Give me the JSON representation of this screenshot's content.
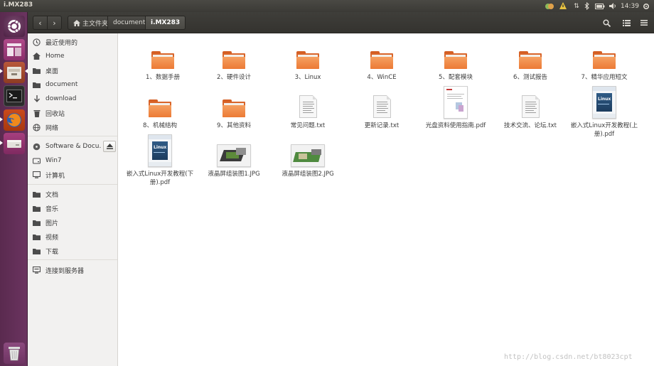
{
  "window": {
    "title": "i.MX283"
  },
  "panel": {
    "time": "14:39"
  },
  "header": {
    "breadcrumbs": [
      {
        "label": "主文件夹",
        "active": false
      },
      {
        "label": "document",
        "active": false
      },
      {
        "label": "i.MX283",
        "active": true
      }
    ]
  },
  "sidebar": {
    "places": [
      {
        "label": "最近使用的",
        "icon": "clock-icon"
      },
      {
        "label": "Home",
        "icon": "home-icon"
      },
      {
        "label": "桌面",
        "icon": "folder-icon"
      },
      {
        "label": "document",
        "icon": "folder-icon"
      },
      {
        "label": "download",
        "icon": "download-icon"
      },
      {
        "label": "回收站",
        "icon": "trash-icon"
      },
      {
        "label": "网络",
        "icon": "network-icon"
      }
    ],
    "devices": [
      {
        "label": "Software & Docu...",
        "icon": "disc-icon"
      },
      {
        "label": "Win7",
        "icon": "drive-icon"
      },
      {
        "label": "计算机",
        "icon": "computer-icon"
      }
    ],
    "bookmarks": [
      {
        "label": "文档",
        "icon": "folder-icon"
      },
      {
        "label": "音乐",
        "icon": "folder-icon"
      },
      {
        "label": "图片",
        "icon": "folder-icon"
      },
      {
        "label": "视频",
        "icon": "folder-icon"
      },
      {
        "label": "下载",
        "icon": "folder-icon"
      }
    ],
    "network": [
      {
        "label": "连接到服务器",
        "icon": "server-icon"
      }
    ]
  },
  "files": [
    {
      "name": "1、数据手册",
      "type": "folder"
    },
    {
      "name": "2、硬件设计",
      "type": "folder"
    },
    {
      "name": "3、Linux",
      "type": "folder"
    },
    {
      "name": "4、WinCE",
      "type": "folder"
    },
    {
      "name": "5、配套模块",
      "type": "folder"
    },
    {
      "name": "6、测试报告",
      "type": "folder"
    },
    {
      "name": "7、精华应用短文",
      "type": "folder"
    },
    {
      "name": "8、机械结构",
      "type": "folder"
    },
    {
      "name": "9、其他资料",
      "type": "folder"
    },
    {
      "name": "常见问题.txt",
      "type": "txt"
    },
    {
      "name": "更新记录.txt",
      "type": "txt"
    },
    {
      "name": "光盘资料使用指南.pdf",
      "type": "pdf-doc"
    },
    {
      "name": "技术交流、论坛.txt",
      "type": "txt"
    },
    {
      "name": "嵌入式Linux开发教程(上册).pdf",
      "type": "pdf-book",
      "cover_text": "Linux"
    },
    {
      "name": "嵌入式Linux开发教程(下册).pdf",
      "type": "pdf-book",
      "cover_text": "Linux"
    },
    {
      "name": "液晶屏组装图1.JPG",
      "type": "jpg"
    },
    {
      "name": "液晶屏组装图2.JPG",
      "type": "jpg"
    }
  ],
  "watermark": "http://blog.csdn.net/bt8023cpt",
  "colors": {
    "launcher": "#5e2d55",
    "folder": "#ec7a35",
    "panel": "#3c3b37"
  }
}
